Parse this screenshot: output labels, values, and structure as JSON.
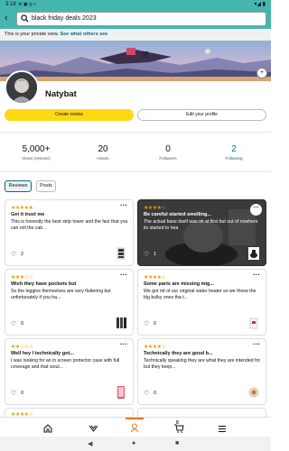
{
  "status_bar": {
    "time": "3:18",
    "icons": "⚙ ▣ ◎ •",
    "right": "▾◢ ▮"
  },
  "search": {
    "query": "black friday deals 2023"
  },
  "privacy": {
    "text": "This is your private view.",
    "link": "See what others see"
  },
  "profile": {
    "name": "Natybat"
  },
  "buttons": {
    "create_review": "Create review",
    "edit_profile": "Edit your profile"
  },
  "stats": [
    {
      "value": "5,000+",
      "label": "Views (reviews)"
    },
    {
      "value": "20",
      "label": "Hearts"
    },
    {
      "value": "0",
      "label": "Followers"
    },
    {
      "value": "2",
      "label": "Following"
    }
  ],
  "tabs": {
    "reviews": "Reviews",
    "posts": "Posts"
  },
  "reviews": [
    {
      "stars": "★★★★★",
      "title": "Get it trust me",
      "body": "This is honestly the best strip tower and the fact that you can roll the cab...",
      "hearts": "2"
    },
    {
      "stars": "★★★★☆",
      "title": "Be careful started smelling...",
      "body": "The actual base itself was ok at first but out of nowhere its started to hea",
      "hearts": "1"
    },
    {
      "stars": "★★★☆☆",
      "title": "Wish they have pockets but",
      "body": "So the leggins themselves are very fluttering but unfortunately if you ha...",
      "hearts": "0"
    },
    {
      "stars": "★★★★☆",
      "title": "Some parts are missing mig...",
      "body": "We got rid of our original water heater so we threw the blg bulky ones tha t...",
      "hearts": "0"
    },
    {
      "stars": "★★☆☆☆",
      "title": "Well hey I technically got...",
      "body": "I was looking for an in screen protector case with full coverage and that woul...",
      "hearts": "0"
    },
    {
      "stars": "★★★★☆",
      "title": "Technically they are good b...",
      "body": "Technically speaking they are what they are intended for but they keep...",
      "hearts": "0"
    }
  ],
  "more_label": "···",
  "nav": {
    "home": "home-icon",
    "rewards": "rewards-icon",
    "profile": "profile-icon",
    "cart": "cart-icon",
    "cart_count": "0",
    "menu": "menu-icon"
  },
  "colors": {
    "header": "#45b5b0",
    "create_button": "#ffd814",
    "accent": "#e47911",
    "link": "#0f6a84",
    "star": "#e59a00"
  }
}
